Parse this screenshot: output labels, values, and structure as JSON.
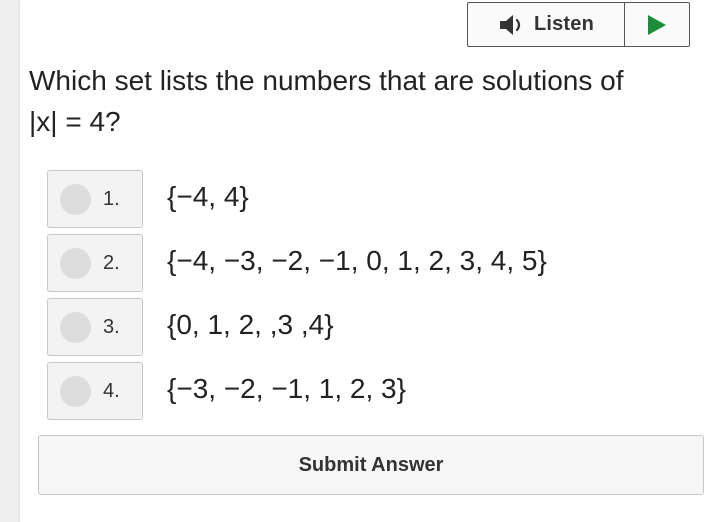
{
  "listen": {
    "label": "Listen",
    "speaker_icon": "speaker-icon",
    "play_icon": "play-icon",
    "play_color": "#1e8a3c"
  },
  "question": {
    "line1": "Which set lists the numbers that are solutions of",
    "line2": "|x| = 4?"
  },
  "options": [
    {
      "number": "1.",
      "text": "{−4, 4}"
    },
    {
      "number": "2.",
      "text": "{−4, −3, −2, −1, 0, 1, 2, 3, 4, 5}"
    },
    {
      "number": "3.",
      "text": "{0, 1, 2, ,3 ,4}"
    },
    {
      "number": "4.",
      "text": "{−3, −2, −1, 1, 2, 3}"
    }
  ],
  "submit": {
    "label": "Submit Answer"
  }
}
